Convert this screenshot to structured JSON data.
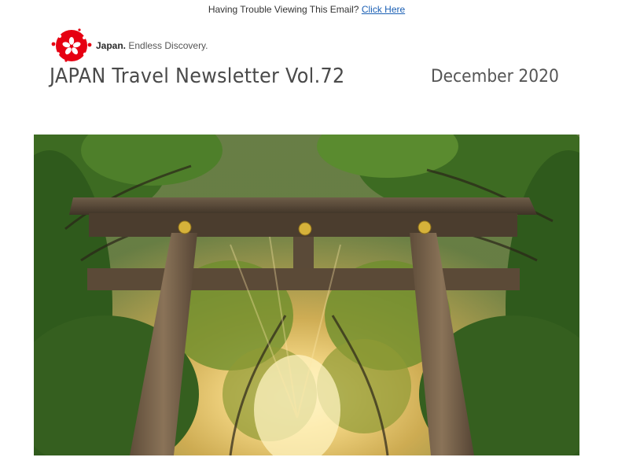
{
  "preheader": {
    "text": "Having Trouble Viewing This Email?",
    "link_label": "Click Here"
  },
  "logo": {
    "brand": "Japan.",
    "tagline": "Endless Discovery.",
    "icon": "cherry-blossom-icon",
    "color": "#e60012"
  },
  "header": {
    "title": "JAPAN Travel Newsletter Vol.72",
    "date": "December 2020"
  },
  "hero": {
    "icon": "torii-gate-forest-image",
    "link_color": "#1a5fb4"
  }
}
